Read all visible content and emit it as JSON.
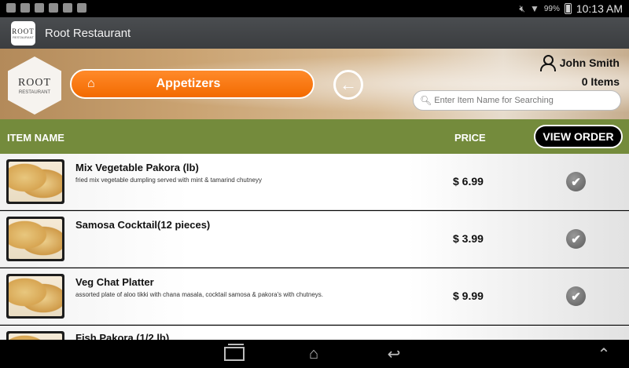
{
  "status_bar": {
    "battery": "99%",
    "time": "10:13 AM"
  },
  "app_bar": {
    "title": "Root Restaurant",
    "icon_text": "ROOT",
    "icon_subtext": "RESTAURANT"
  },
  "header": {
    "logo_text": "ROOT",
    "logo_subtext": "RESTAURANT",
    "category_label": "Appetizers",
    "user_name": "John Smith",
    "item_count": "0 Items",
    "search_placeholder": "Enter Item Name for Searching"
  },
  "columns": {
    "item_name": "ITEM NAME",
    "price": "PRICE",
    "view_order": "VIEW ORDER"
  },
  "items": [
    {
      "name": "Mix Vegetable Pakora (lb)",
      "description": "fried mix vegetable dumpling served with mint & tamarind chutneyy",
      "price": "$ 6.99"
    },
    {
      "name": "Samosa Cocktail(12 pieces)",
      "description": "",
      "price": "$ 3.99"
    },
    {
      "name": "Veg Chat Platter",
      "description": "assorted plate of aloo tikki with chana masala, cocktail samosa & pakora's with chutneys.",
      "price": "$ 9.99"
    },
    {
      "name": "Fish Pakora (1/2 lb)",
      "description": "",
      "price": ""
    }
  ],
  "icons": {
    "status_left": [
      "usb-icon",
      "facebook-icon",
      "image-icon",
      "play-store-icon",
      "shopping-bag-icon",
      "shopping-bag-icon"
    ],
    "status_right": [
      "mute-icon",
      "wifi-icon",
      "battery-icon"
    ],
    "nav": [
      "recent-apps-icon",
      "home-icon",
      "back-icon",
      "collapse-icon"
    ]
  },
  "colors": {
    "accent_orange": "#f36a00",
    "header_green": "#748b3c",
    "action_bar": "#3b3d40"
  }
}
